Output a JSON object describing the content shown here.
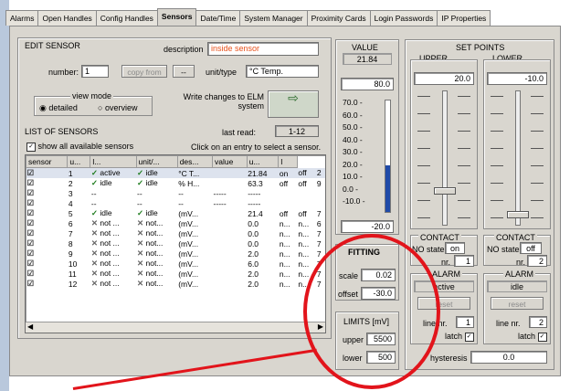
{
  "tabs": [
    "Alarms",
    "Open Handles",
    "Config Handles",
    "Sensors",
    "Date/Time",
    "System Manager",
    "Proximity Cards",
    "Login Passwords",
    "IP Properties"
  ],
  "active_tab": "Sensors",
  "edit_sensor": {
    "title": "EDIT SENSOR",
    "description_label": "description",
    "description_value": "inside sensor",
    "number_label": "number:",
    "number_value": "1",
    "copy_from_label": "copy from",
    "copy_from_value": "--",
    "unit_label": "unit/type",
    "unit_value": "°C Temp.",
    "view_mode_label": "view mode",
    "detailed_label": "detailed",
    "overview_label": "overview",
    "write_label": "Write changes to ELM system",
    "last_read_label": "last read:",
    "last_read_value": "1-12"
  },
  "list": {
    "title": "LIST OF SENSORS",
    "show_all_label": "show all available sensors",
    "hint": "Click on an entry to select a sensor.",
    "headers": [
      "sensor",
      "u...",
      "l...",
      "unit/...",
      "des...",
      "value",
      "u...",
      "l"
    ],
    "rows": [
      {
        "n": "1",
        "s1": "active",
        "s2": "idle",
        "unit": "°C T...",
        "des": "",
        "value": "21.84",
        "a": "on",
        "b": "off",
        "c": "2"
      },
      {
        "n": "2",
        "s1": "idle",
        "s2": "idle",
        "unit": "% H...",
        "des": "",
        "value": "63.3",
        "a": "off",
        "b": "off",
        "c": "9"
      },
      {
        "n": "3",
        "s1": "--",
        "s2": "--",
        "unit": "--",
        "des": "-----",
        "value": "-----",
        "a": "",
        "b": "",
        "c": ""
      },
      {
        "n": "4",
        "s1": "--",
        "s2": "--",
        "unit": "--",
        "des": "-----",
        "value": "-----",
        "a": "",
        "b": "",
        "c": ""
      },
      {
        "n": "5",
        "s1": "idle",
        "s2": "idle",
        "unit": "(mV...",
        "des": "",
        "value": "21.4",
        "a": "off",
        "b": "off",
        "c": "7"
      },
      {
        "n": "6",
        "s1": "not ...",
        "s2": "not...",
        "unit": "(mV...",
        "des": "",
        "value": "0.0",
        "a": "n...",
        "b": "n...",
        "c": "6"
      },
      {
        "n": "7",
        "s1": "not ...",
        "s2": "not...",
        "unit": "(mV...",
        "des": "",
        "value": "0.0",
        "a": "n...",
        "b": "n...",
        "c": "7"
      },
      {
        "n": "8",
        "s1": "not ...",
        "s2": "not...",
        "unit": "(mV...",
        "des": "",
        "value": "0.0",
        "a": "n...",
        "b": "n...",
        "c": "7"
      },
      {
        "n": "9",
        "s1": "not ...",
        "s2": "not...",
        "unit": "(mV...",
        "des": "",
        "value": "2.0",
        "a": "n...",
        "b": "n...",
        "c": "7"
      },
      {
        "n": "10",
        "s1": "not ...",
        "s2": "not...",
        "unit": "(mV...",
        "des": "",
        "value": "6.0",
        "a": "n...",
        "b": "n...",
        "c": "7"
      },
      {
        "n": "11",
        "s1": "not ...",
        "s2": "not...",
        "unit": "(mV...",
        "des": "",
        "value": "2.0",
        "a": "n...",
        "b": "n...",
        "c": "7"
      },
      {
        "n": "12",
        "s1": "not ...",
        "s2": "not...",
        "unit": "(mV...",
        "des": "",
        "value": "2.0",
        "a": "n...",
        "b": "n...",
        "c": "7"
      }
    ]
  },
  "value_panel": {
    "title": "VALUE",
    "current": "21.84",
    "top": "80.0",
    "ticks": [
      "70.0 -",
      "60.0 -",
      "50.0 -",
      "40.0 -",
      "30.0 -",
      "20.0 -",
      "10.0 -",
      "0.0 -",
      "-10.0 -"
    ],
    "bottom": "-20.0",
    "level_fraction": 0.42
  },
  "fitting": {
    "title": "FITTING",
    "scale_label": "scale",
    "scale_value": "0.02",
    "offset_label": "offset",
    "offset_value": "-30.0"
  },
  "limits": {
    "title": "LIMITS [mV]",
    "upper_label": "upper",
    "upper_value": "5500",
    "lower_label": "lower",
    "lower_value": "500"
  },
  "set_points": {
    "title": "SET POINTS",
    "upper_label": "UPPER",
    "upper_value": "20.0",
    "lower_label": "LOWER",
    "lower_value": "-10.0"
  },
  "contact": {
    "upper": {
      "title": "CONTACT",
      "no_state_label": "NO state",
      "no_state_value": "on",
      "nr_label": "nr.",
      "nr_value": "1"
    },
    "lower": {
      "title": "CONTACT",
      "no_state_label": "NO state",
      "no_state_value": "off",
      "nr_label": "nr.",
      "nr_value": "2"
    }
  },
  "alarm": {
    "upper": {
      "title": "ALARM",
      "status": "active",
      "reset": "reset",
      "line_label": "line nr.",
      "line_value": "1",
      "latch_label": "latch"
    },
    "lower": {
      "title": "ALARM",
      "status": "idle",
      "reset": "reset",
      "line_label": "line nr.",
      "line_value": "2",
      "latch_label": "latch"
    }
  },
  "hysteresis": {
    "label": "hysteresis",
    "value": "0.0"
  },
  "colors": {
    "highlight_circle": "#e2141b",
    "level_bar": "#1f4aa8",
    "side_panel": "#b9c8dc"
  }
}
